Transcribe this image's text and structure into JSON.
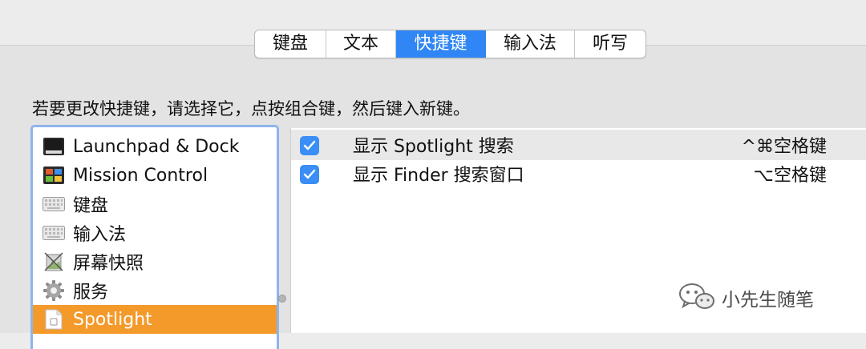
{
  "tabs": [
    {
      "label": "键盘"
    },
    {
      "label": "文本"
    },
    {
      "label": "快捷键",
      "active": true
    },
    {
      "label": "输入法"
    },
    {
      "label": "听写"
    }
  ],
  "instruction": "若要更改快捷键，请选择它，点按组合键，然后键入新键。",
  "sidebar": {
    "items": [
      {
        "label": "Launchpad & Dock",
        "icon": "launchpad-dock-icon"
      },
      {
        "label": "Mission Control",
        "icon": "mission-control-icon"
      },
      {
        "label": "键盘",
        "icon": "keyboard-icon"
      },
      {
        "label": "输入法",
        "icon": "keyboard-icon"
      },
      {
        "label": "屏幕快照",
        "icon": "screenshot-icon"
      },
      {
        "label": "服务",
        "icon": "gear-icon"
      },
      {
        "label": "Spotlight",
        "icon": "spotlight-document-icon",
        "selected": true
      }
    ]
  },
  "shortcuts": [
    {
      "checked": true,
      "label": "显示 Spotlight 搜索",
      "keys": "^⌘空格键"
    },
    {
      "checked": true,
      "label": "显示 Finder 搜索窗口",
      "keys": "⌥空格键"
    }
  ],
  "watermark": {
    "text": "小先生随笔",
    "icon": "wechat-icon"
  },
  "colors": {
    "accent": "#2f86f4",
    "selection": "#f39a2b",
    "checkbox": "#3a8ef6",
    "focus_ring": "#8db5ee"
  }
}
